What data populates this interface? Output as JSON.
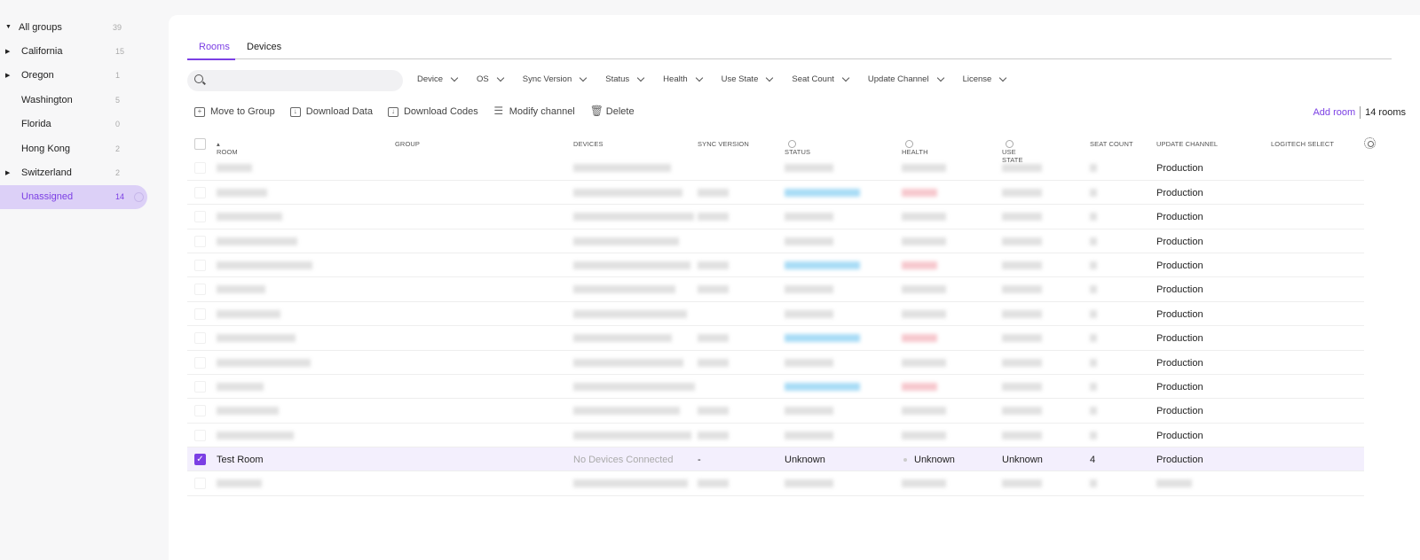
{
  "sidebar": {
    "groups": [
      {
        "label": "All groups",
        "count": "39",
        "expand": "open"
      },
      {
        "label": "California",
        "count": "15",
        "expand": "closed"
      },
      {
        "label": "Oregon",
        "count": "1",
        "expand": "closed"
      },
      {
        "label": "Washington",
        "count": "5",
        "expand": "none"
      },
      {
        "label": "Florida",
        "count": "0",
        "expand": "none"
      },
      {
        "label": "Hong Kong",
        "count": "2",
        "expand": "none"
      },
      {
        "label": "Switzerland",
        "count": "2",
        "expand": "closed"
      },
      {
        "label": "Unassigned",
        "count": "14",
        "expand": "none",
        "active": true
      }
    ]
  },
  "tabs": [
    "Rooms",
    "Devices"
  ],
  "search": {
    "placeholder": ""
  },
  "filters": [
    "Device",
    "OS",
    "Sync Version",
    "Status",
    "Health",
    "Use State",
    "Seat Count",
    "Update Channel",
    "License"
  ],
  "actions": [
    "Move to Group",
    "Download Data",
    "Download Codes",
    "Modify channel",
    "Delete"
  ],
  "add_room": "Add room",
  "room_count": "14 rooms",
  "columns": [
    "ROOM",
    "GROUP",
    "DEVICES",
    "SYNC VERSION",
    "STATUS",
    "HEALTH",
    "USE STATE",
    "SEAT COUNT",
    "UPDATE CHANNEL",
    "LOGITECH SELECT"
  ],
  "rows": [
    {
      "blurred": true,
      "update_channel": "Production"
    },
    {
      "blurred": true,
      "update_channel": "Production",
      "accent": true
    },
    {
      "blurred": true,
      "update_channel": "Production"
    },
    {
      "blurred": true,
      "update_channel": "Production"
    },
    {
      "blurred": true,
      "update_channel": "Production",
      "accent": true
    },
    {
      "blurred": true,
      "update_channel": "Production"
    },
    {
      "blurred": true,
      "update_channel": "Production"
    },
    {
      "blurred": true,
      "update_channel": "Production",
      "accent": true
    },
    {
      "blurred": true,
      "update_channel": "Production"
    },
    {
      "blurred": true,
      "update_channel": "Production",
      "accent": true
    },
    {
      "blurred": true,
      "update_channel": "Production"
    },
    {
      "blurred": true,
      "update_channel": "Production"
    },
    {
      "blurred": false,
      "selected": true,
      "room": "Test Room",
      "devices": "No Devices Connected",
      "sync_version": "-",
      "status": "Unknown",
      "health": "Unknown",
      "use_state": "Unknown",
      "seat_count": "4",
      "update_channel": "Production"
    },
    {
      "blurred": true
    }
  ],
  "colors": {
    "accent": "#7b3fe4",
    "active_bg": "#dcd0f7",
    "selected_row": "#f3effd"
  }
}
